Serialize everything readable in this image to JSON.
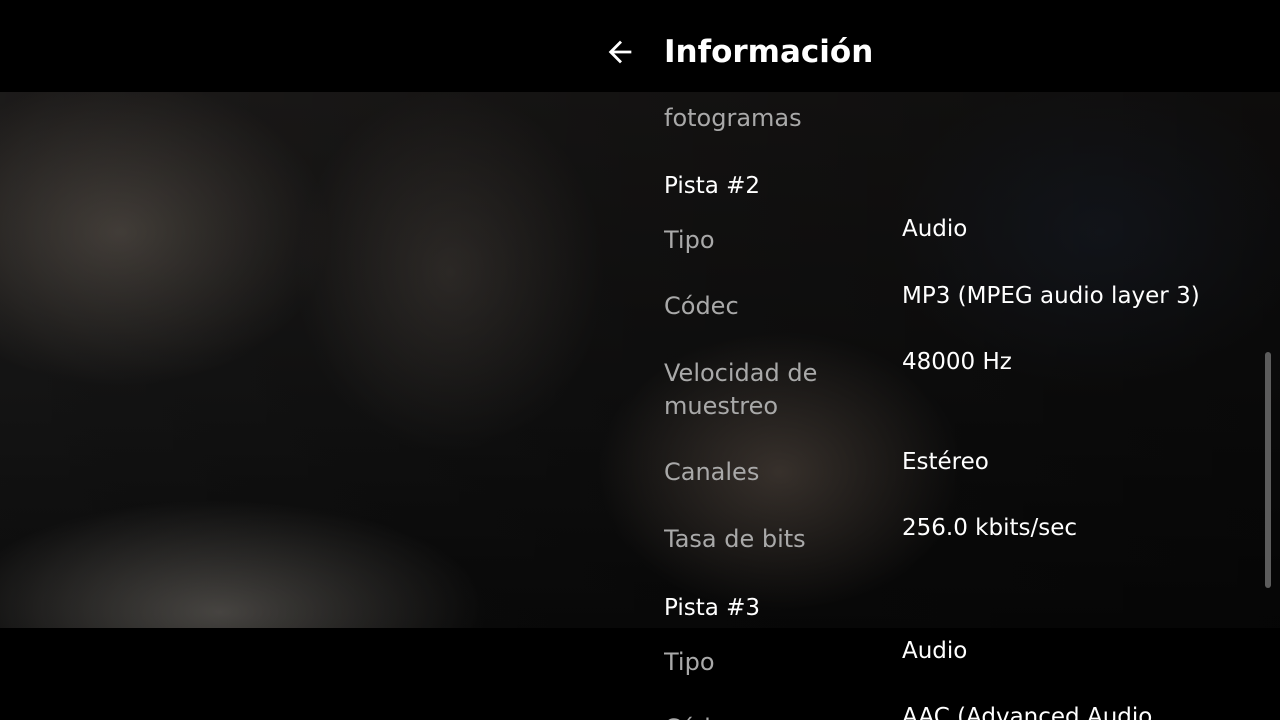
{
  "header": {
    "title": "Información",
    "back_icon": "arrow-left-icon"
  },
  "info": {
    "partial_label": "fotogramas",
    "tracks": [
      {
        "heading": "Pista #2",
        "rows": [
          {
            "label": "Tipo",
            "value": "Audio"
          },
          {
            "label": "Códec",
            "value": "MP3 (MPEG audio layer 3)"
          },
          {
            "label": "Velocidad de muestreo",
            "value": "48000 Hz"
          },
          {
            "label": "Canales",
            "value": "Estéreo"
          },
          {
            "label": "Tasa de bits",
            "value": "256.0 kbits/sec"
          }
        ]
      },
      {
        "heading": "Pista #3",
        "rows": [
          {
            "label": "Tipo",
            "value": "Audio"
          },
          {
            "label": "Códec",
            "value": "AAC (Advanced Audio"
          }
        ]
      }
    ]
  },
  "colors": {
    "background": "#000000",
    "label": "#a9a9a9",
    "value": "#ffffff",
    "scrollbar": "#5c5c5c"
  }
}
